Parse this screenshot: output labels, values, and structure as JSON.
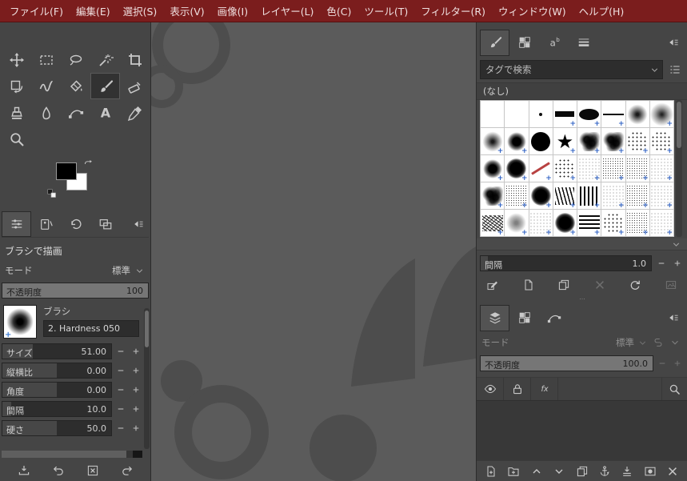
{
  "colors": {
    "menubar_bg": "#7b1d1d",
    "panel_bg": "#454545",
    "canvas_bg": "#5b5b5b",
    "watermark": "#4d4d4d",
    "plus_badge": "#2f62c4"
  },
  "menu_bar": {
    "items": [
      "ファイル(F)",
      "編集(E)",
      "選択(S)",
      "表示(V)",
      "画像(I)",
      "レイヤー(L)",
      "色(C)",
      "ツール(T)",
      "フィルター(R)",
      "ウィンドウ(W)",
      "ヘルプ(H)"
    ]
  },
  "toolbox": {
    "tools": [
      {
        "name": "move-tool",
        "icon": "move"
      },
      {
        "name": "rectangle-select-tool",
        "icon": "rectselect"
      },
      {
        "name": "free-select-tool",
        "icon": "lasso"
      },
      {
        "name": "fuzzy-select-tool",
        "icon": "wand"
      },
      {
        "name": "crop-tool",
        "icon": "crop"
      },
      {
        "name": "transform-tool",
        "icon": "transform"
      },
      {
        "name": "warp-transform-tool",
        "icon": "warp"
      },
      {
        "name": "bucket-fill-tool",
        "icon": "bucket"
      },
      {
        "name": "paintbrush-tool",
        "icon": "paintbrush",
        "active": true
      },
      {
        "name": "eraser-tool",
        "icon": "eraser"
      },
      {
        "name": "clone-tool",
        "icon": "clone"
      },
      {
        "name": "smudge-tool",
        "icon": "smudge"
      },
      {
        "name": "paths-tool",
        "icon": "paths"
      },
      {
        "name": "text-tool",
        "icon": "texticon"
      },
      {
        "name": "color-picker-tool",
        "icon": "picker"
      },
      {
        "name": "zoom-tool",
        "icon": "zoom"
      }
    ],
    "colors": {
      "foreground": "#000000",
      "background": "#ffffff"
    },
    "dock_tabs": [
      {
        "name": "tab-tool-options",
        "icon": "tooloptions",
        "active": true
      },
      {
        "name": "tab-device-status",
        "icon": "device"
      },
      {
        "name": "tab-undo-history",
        "icon": "history"
      },
      {
        "name": "tab-images",
        "icon": "images"
      }
    ],
    "tool_options": {
      "title": "ブラシで描画",
      "mode_label": "モード",
      "mode_value": "標準",
      "opacity_label": "不透明度",
      "opacity_value": "100",
      "brush_section_label": "ブラシ",
      "brush_name": "2. Hardness 050",
      "sliders": [
        {
          "name": "size-slider",
          "label": "サイズ",
          "value": "51.00",
          "fill": 28
        },
        {
          "name": "aspect-ratio-slider",
          "label": "縦横比",
          "value": "0.00",
          "fill": 50
        },
        {
          "name": "angle-slider",
          "label": "角度",
          "value": "0.00",
          "fill": 50
        },
        {
          "name": "spacing-slider",
          "label": "間隔",
          "value": "10.0",
          "fill": 8
        },
        {
          "name": "hardness-slider",
          "label": "硬さ",
          "value": "50.0",
          "fill": 50
        }
      ]
    },
    "footer_buttons": [
      {
        "name": "save-tool-options-button",
        "icon": "savetray"
      },
      {
        "name": "restore-tool-options-button",
        "icon": "undo"
      },
      {
        "name": "delete-tool-options-button",
        "icon": "deletebox"
      },
      {
        "name": "reset-tool-options-button",
        "icon": "redo"
      }
    ]
  },
  "brushes_panel": {
    "tabs": [
      {
        "name": "tab-brushes",
        "icon": "paintbrush",
        "active": true
      },
      {
        "name": "tab-patterns",
        "icon": "checker"
      },
      {
        "name": "tab-fonts",
        "icon": "fonts"
      },
      {
        "name": "tab-gradients",
        "icon": "gradient"
      }
    ],
    "search_placeholder": "タグで検索",
    "tag_none_label": "(なし)",
    "cells": [
      {
        "type": "blank",
        "plus": false
      },
      {
        "type": "blank",
        "plus": false
      },
      {
        "type": "dot",
        "plus": false
      },
      {
        "type": "bar",
        "plus": true
      },
      {
        "type": "ellipse",
        "plus": true
      },
      {
        "type": "hline",
        "plus": true
      },
      {
        "type": "soft",
        "plus": false
      },
      {
        "type": "softlg",
        "plus": true
      },
      {
        "type": "soft",
        "plus": true
      },
      {
        "type": "soft2",
        "plus": true
      },
      {
        "type": "hard",
        "plus": false
      },
      {
        "type": "star",
        "plus": true
      },
      {
        "type": "splat",
        "plus": true
      },
      {
        "type": "splat",
        "plus": true
      },
      {
        "type": "speck",
        "plus": true
      },
      {
        "type": "speck",
        "plus": true
      },
      {
        "type": "soft2",
        "plus": true
      },
      {
        "type": "darkblob",
        "plus": true
      },
      {
        "type": "redstroke",
        "plus": true
      },
      {
        "type": "speck",
        "plus": true
      },
      {
        "type": "noise2",
        "plus": true
      },
      {
        "type": "noise",
        "plus": true
      },
      {
        "type": "noise",
        "plus": true
      },
      {
        "type": "noise2",
        "plus": true
      },
      {
        "type": "splat",
        "plus": true
      },
      {
        "type": "noise",
        "plus": true
      },
      {
        "type": "darkblob",
        "plus": true
      },
      {
        "type": "grass",
        "plus": true
      },
      {
        "type": "vlines",
        "plus": true
      },
      {
        "type": "noise2",
        "plus": true
      },
      {
        "type": "noise",
        "plus": true
      },
      {
        "type": "noise2",
        "plus": true
      },
      {
        "type": "scribble",
        "plus": true
      },
      {
        "type": "smoke",
        "plus": true
      },
      {
        "type": "noise2",
        "plus": true
      },
      {
        "type": "darkblob",
        "plus": true
      },
      {
        "type": "lines",
        "plus": true
      },
      {
        "type": "speck",
        "plus": true
      },
      {
        "type": "noise",
        "plus": true
      },
      {
        "type": "noise2",
        "plus": true
      }
    ],
    "spacing_label": "間隔",
    "spacing_value": "1.0",
    "actions": [
      {
        "name": "edit-brush-button",
        "icon": "editbrush"
      },
      {
        "name": "new-brush-button",
        "icon": "newdoc"
      },
      {
        "name": "duplicate-brush-button",
        "icon": "duplicate"
      },
      {
        "name": "delete-brush-button",
        "icon": "deletex",
        "disabled": true
      },
      {
        "name": "refresh-brushes-button",
        "icon": "refresh"
      },
      {
        "name": "open-brush-as-image-button",
        "icon": "openimg",
        "disabled": true
      }
    ]
  },
  "layers_panel": {
    "tabs": [
      {
        "name": "tab-layers",
        "icon": "layers",
        "active": true
      },
      {
        "name": "tab-channels",
        "icon": "checker"
      },
      {
        "name": "tab-paths",
        "icon": "pathsicon"
      }
    ],
    "mode_label": "モード",
    "mode_value": "標準",
    "opacity_label": "不透明度",
    "opacity_value": "100.0",
    "header_buttons": [
      {
        "name": "layer-visibility-toggle",
        "icon": "eye"
      },
      {
        "name": "layer-lock-toggle",
        "icon": "lock"
      },
      {
        "name": "layer-effects-toggle",
        "icon": "fx"
      }
    ],
    "footer_buttons": [
      {
        "name": "new-layer-button",
        "icon": "docplus"
      },
      {
        "name": "new-layer-group-button",
        "icon": "folderplus"
      },
      {
        "name": "raise-layer-button",
        "icon": "chevup"
      },
      {
        "name": "lower-layer-button",
        "icon": "chevdown"
      },
      {
        "name": "duplic​ate-layer-button",
        "icon": "duplicate"
      },
      {
        "name": "anchor-layer-button",
        "icon": "anchor"
      },
      {
        "name": "merge-layer-button",
        "icon": "merge"
      },
      {
        "name": "layer-mask-button",
        "icon": "mask"
      },
      {
        "name": "delete-layer-button",
        "icon": "deletex"
      }
    ]
  }
}
